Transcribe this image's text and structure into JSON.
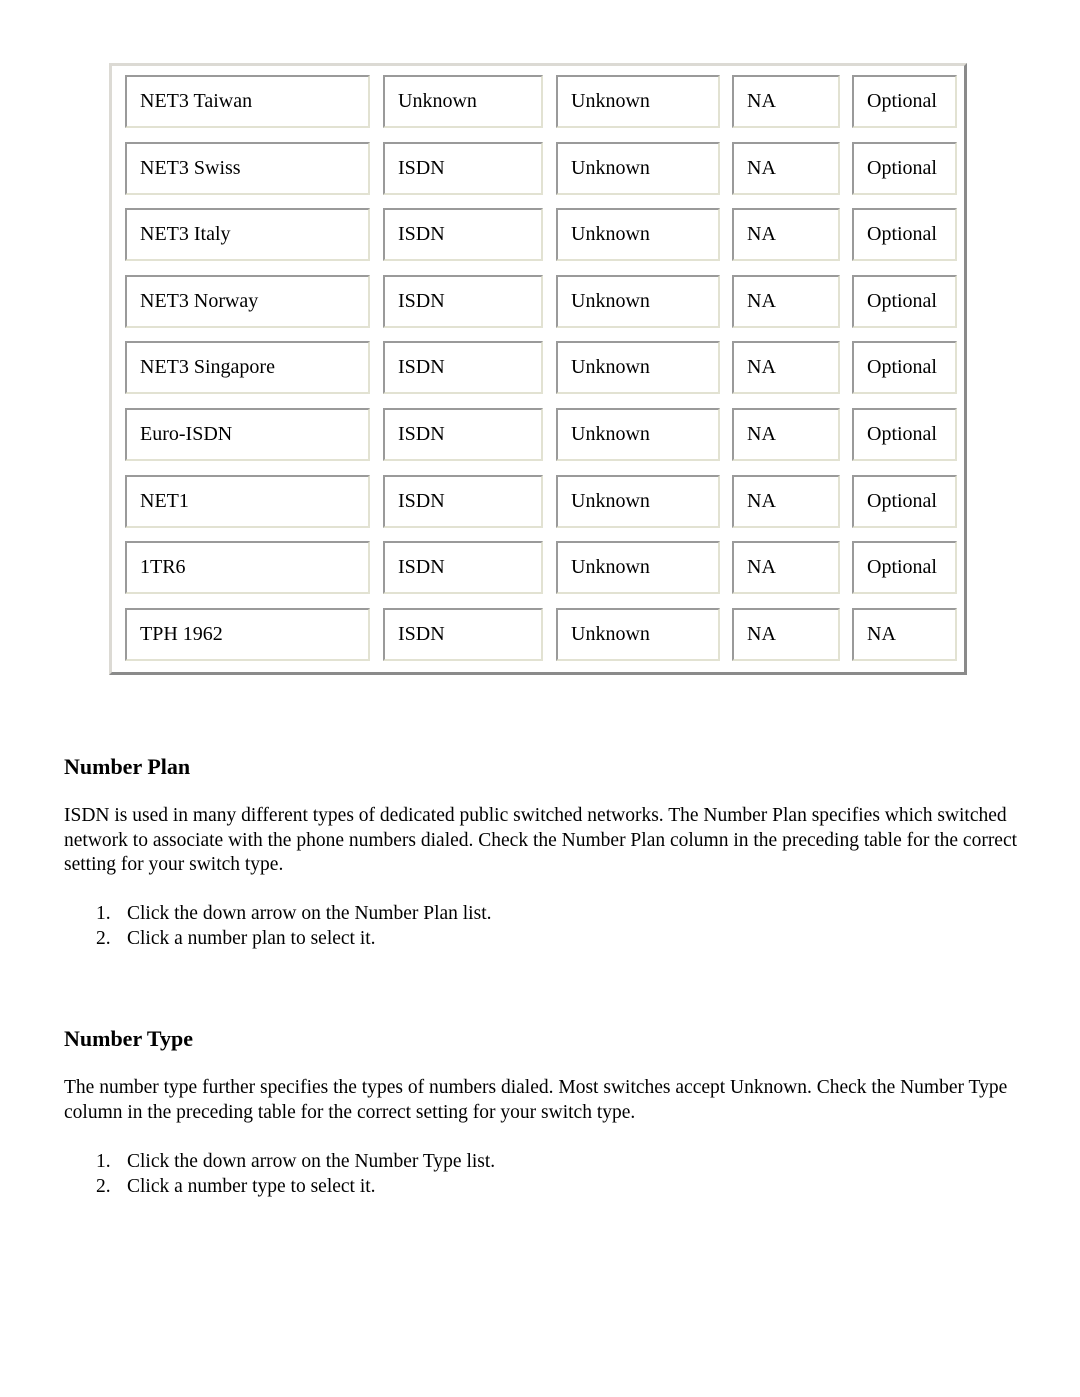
{
  "table": {
    "rows": [
      [
        "NET3 Taiwan",
        "Unknown",
        "Unknown",
        "NA",
        "Optional"
      ],
      [
        "NET3 Swiss",
        "ISDN",
        "Unknown",
        "NA",
        "Optional"
      ],
      [
        "NET3 Italy",
        "ISDN",
        "Unknown",
        "NA",
        "Optional"
      ],
      [
        "NET3 Norway",
        "ISDN",
        "Unknown",
        "NA",
        "Optional"
      ],
      [
        "NET3 Singapore",
        "ISDN",
        "Unknown",
        "NA",
        "Optional"
      ],
      [
        "Euro-ISDN",
        "ISDN",
        "Unknown",
        "NA",
        "Optional"
      ],
      [
        "NET1",
        "ISDN",
        "Unknown",
        "NA",
        "Optional"
      ],
      [
        "1TR6",
        "ISDN",
        "Unknown",
        "NA",
        "Optional"
      ],
      [
        "TPH 1962",
        "ISDN",
        "Unknown",
        "NA",
        "NA"
      ]
    ]
  },
  "number_plan": {
    "heading": "Number Plan",
    "paragraph": "ISDN is used in many different types of dedicated public switched networks. The Number Plan specifies which switched network to associate with the phone numbers dialed. Check the Number Plan column in the preceding table for the correct setting for your switch type.",
    "steps": [
      {
        "num": "1.",
        "text": "Click the down arrow on the Number Plan list."
      },
      {
        "num": "2.",
        "text": "Click a number plan to select it."
      }
    ]
  },
  "number_type": {
    "heading": "Number Type",
    "paragraph": "The number type further specifies the types of numbers dialed. Most switches accept Unknown. Check the Number Type column in the preceding table for the correct setting for your switch type.",
    "steps": [
      {
        "num": "1.",
        "text": "Click the down arrow on the Number Type list."
      },
      {
        "num": "2.",
        "text": "Click a number type to select it."
      }
    ]
  }
}
